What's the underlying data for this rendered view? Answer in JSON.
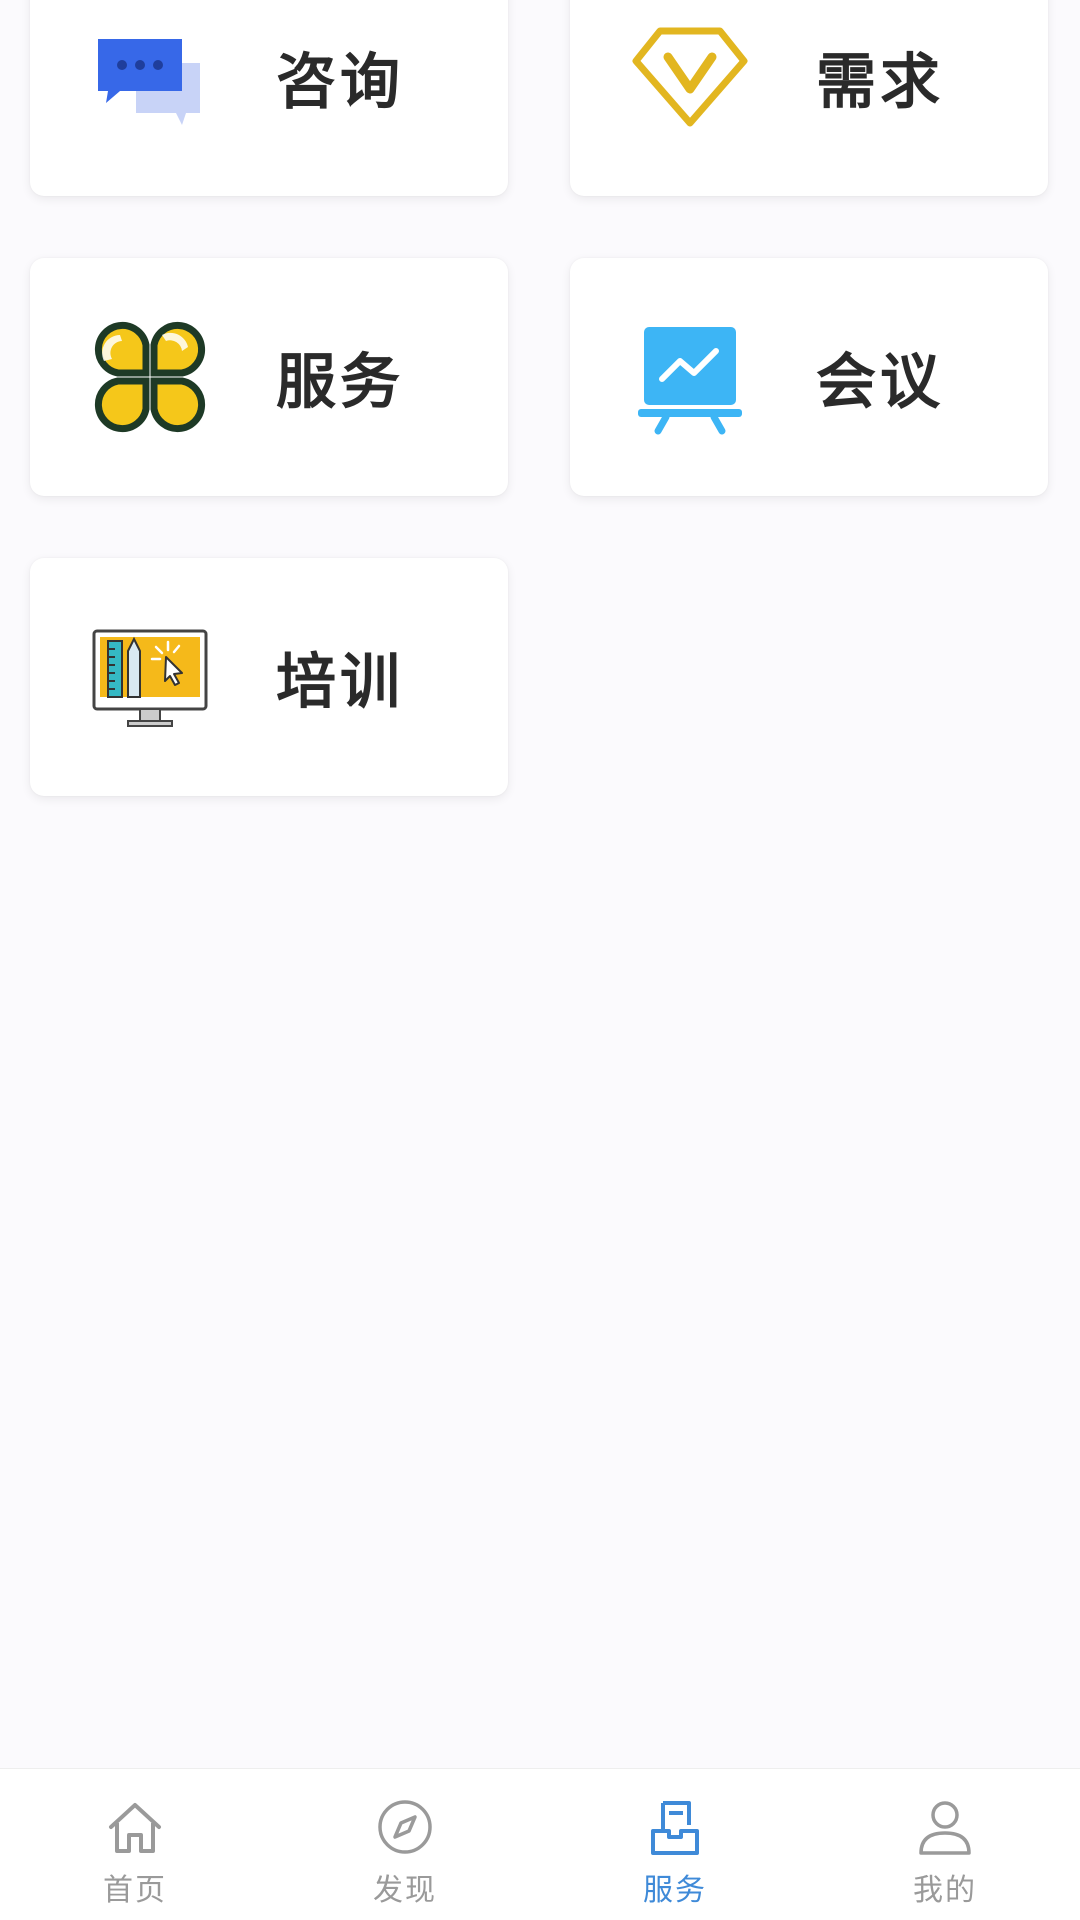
{
  "cards": {
    "consult": {
      "label": "咨询",
      "icon": "chat-bubbles-icon"
    },
    "demand": {
      "label": "需求",
      "icon": "diamond-check-icon"
    },
    "service": {
      "label": "服务",
      "icon": "clover-icon"
    },
    "meeting": {
      "label": "会议",
      "icon": "presentation-board-icon"
    },
    "training": {
      "label": "培训",
      "icon": "design-monitor-icon"
    }
  },
  "tabbar": {
    "active_index": 2,
    "active_color": "#3f8ad8",
    "inactive_color": "#9a9a9a",
    "items": [
      {
        "label": "首页",
        "icon": "home-icon"
      },
      {
        "label": "发现",
        "icon": "compass-icon"
      },
      {
        "label": "服务",
        "icon": "service-inbox-icon"
      },
      {
        "label": "我的",
        "icon": "user-icon"
      }
    ]
  }
}
